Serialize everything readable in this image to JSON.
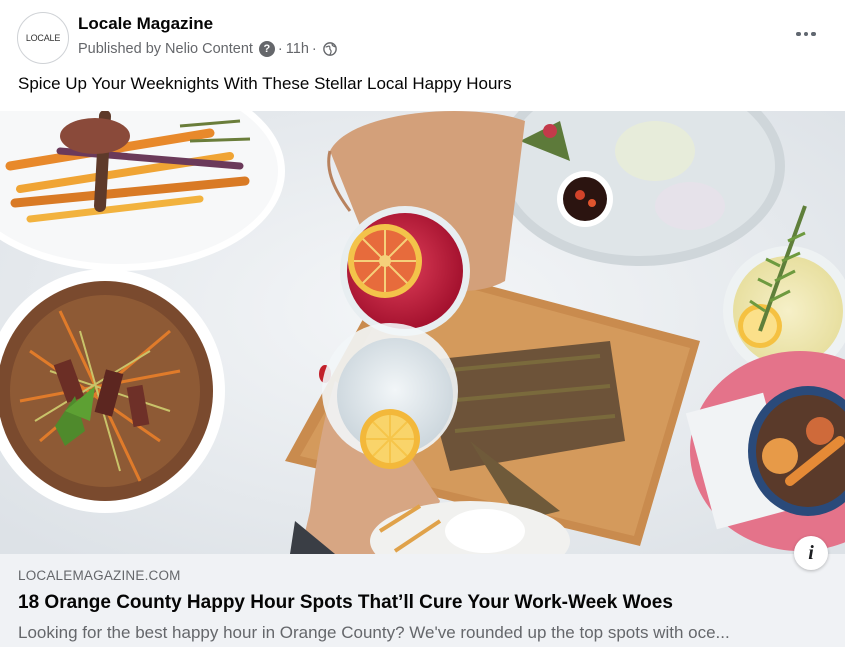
{
  "header": {
    "avatar_text": "LOCALE",
    "page_name": "Locale Magazine",
    "published_by": "Published by Nelio Content",
    "help_glyph": "?",
    "time": "11h",
    "separator": "·",
    "audience_icon": "globe-icon"
  },
  "post": {
    "text": "Spice Up Your Weeknights With These Stellar Local Happy Hours"
  },
  "link_preview": {
    "domain": "LOCALEMAGAZINE.COM",
    "title": "18 Orange County Happy Hour Spots That’ll Cure Your Work-Week Woes",
    "description": "Looking for the best happy hour in Orange County? We've rounded up the top spots with oce...",
    "info_glyph": "i"
  },
  "colors": {
    "text_primary": "#050505",
    "text_secondary": "#65676b",
    "preview_bg": "#f0f2f5",
    "drink_red": "#c2183a",
    "lemon": "#f2b632"
  }
}
